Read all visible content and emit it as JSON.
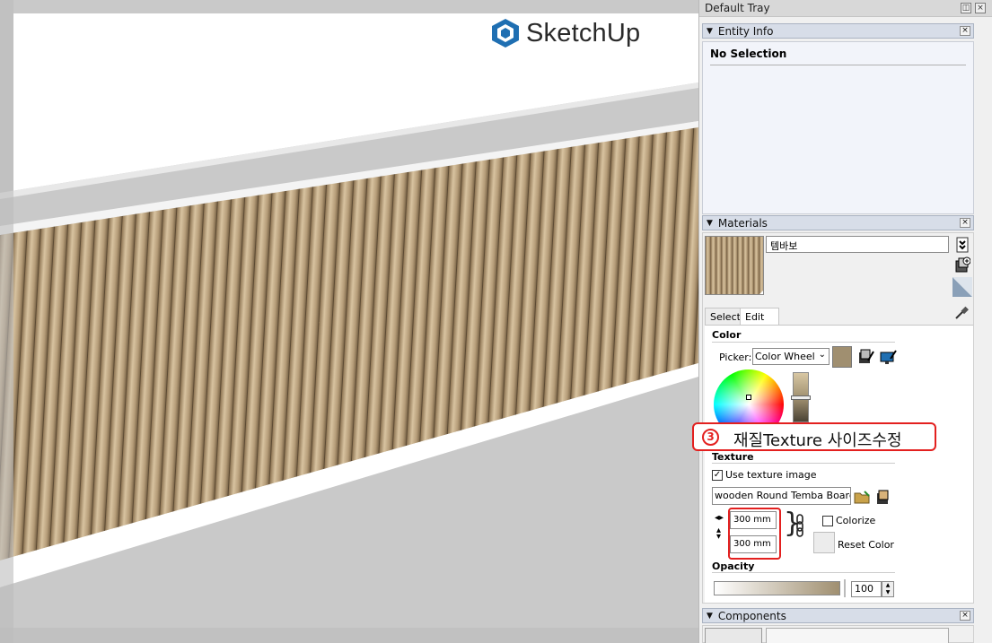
{
  "tray": {
    "title": "Default Tray"
  },
  "entity_info": {
    "title": "Entity Info",
    "label": "No Selection"
  },
  "materials": {
    "title": "Materials",
    "name": "템바보",
    "tabs": {
      "select": "Select",
      "edit": "Edit"
    },
    "color": {
      "section": "Color",
      "picker_label": "Picker:",
      "picker_value": "Color Wheel",
      "swatch": "#a08f70"
    },
    "texture": {
      "section": "Texture",
      "use_texture_label": "Use texture image",
      "use_texture_checked": "✓",
      "file": "wooden Round Temba Board_D",
      "width": "300 mm",
      "height": "300 mm",
      "colorize_label": "Colorize",
      "reset_label": "Reset Color"
    },
    "opacity": {
      "section": "Opacity",
      "value": "100"
    }
  },
  "components": {
    "title": "Components"
  },
  "callout": {
    "number": "3",
    "text": "재질Texture 사이즈수정"
  },
  "viewport": {
    "logo_text": "SketchUp"
  },
  "colors": {
    "accent_red": "#e3201f",
    "wood": "#b59c78",
    "panel_header": "#d7dde8"
  }
}
